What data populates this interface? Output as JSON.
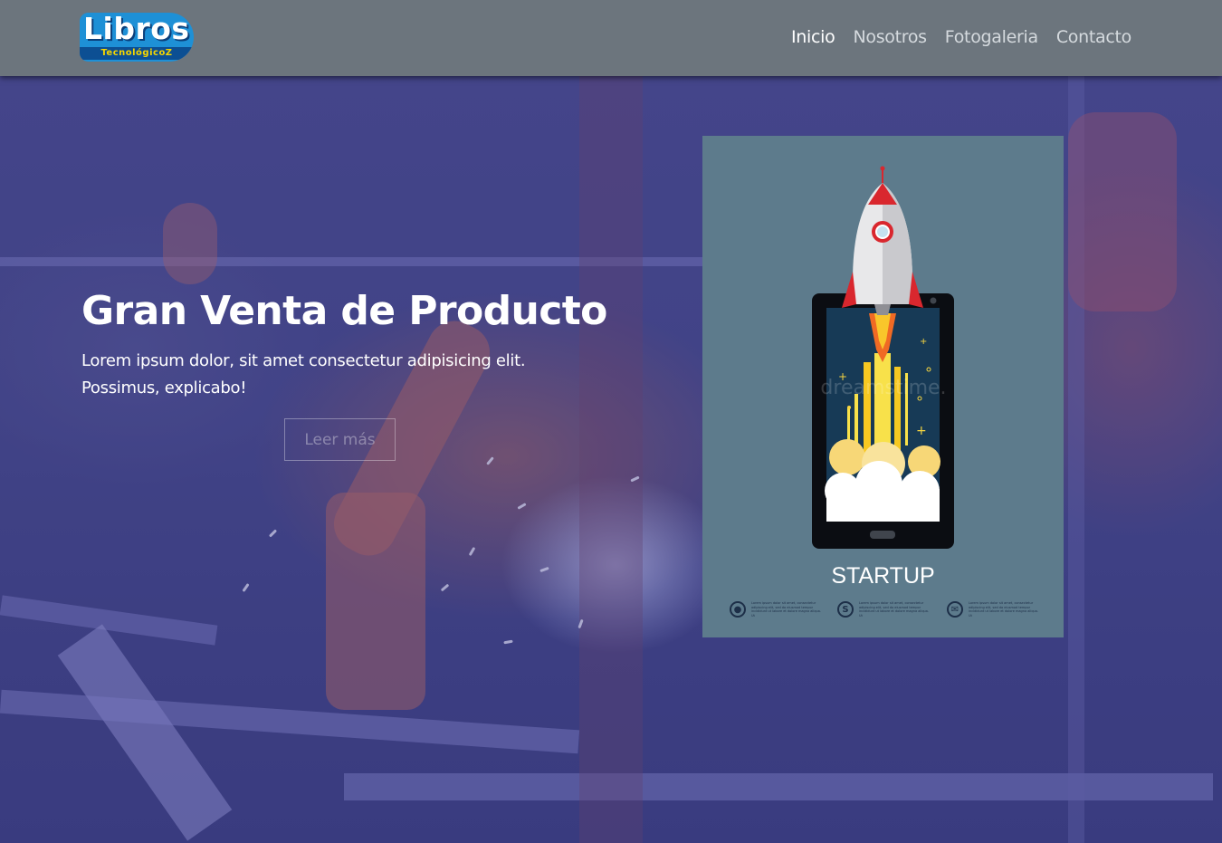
{
  "header": {
    "logo_main": "Libros",
    "logo_sub": "TecnológicoZ",
    "nav": [
      {
        "label": "Inicio",
        "active": true
      },
      {
        "label": "Nosotros",
        "active": false
      },
      {
        "label": "Fotogaleria",
        "active": false
      },
      {
        "label": "Contacto",
        "active": false
      }
    ]
  },
  "hero": {
    "title": "Gran Venta de Producto",
    "text": "Lorem ipsum dolor, sit amet consectetur adipisicing elit. Possimus, explicabo!",
    "button_label": "Leer más"
  },
  "product_card": {
    "title": "STARTUP",
    "watermark": "dreamstime.",
    "features": [
      {
        "icon": "users-icon",
        "symbol": "●",
        "text": "Lorem ipsum dolor sit amet, consectetur adipiscing elit, sed do eiusmod tempor incididunt ut labore et dolore magna aliqua. Ut"
      },
      {
        "icon": "dollar-icon",
        "symbol": "S",
        "text": "Lorem ipsum dolor sit amet, consectetur adipiscing elit, sed do eiusmod tempor incididunt ut labore et dolore magna aliqua. Ut"
      },
      {
        "icon": "mail-icon",
        "symbol": "✉",
        "text": "Lorem ipsum dolor sit amet, consectetur adipiscing elit, sed do eiusmod tempor incididunt ut labore et dolore magna aliqua. Ut"
      }
    ]
  },
  "colors": {
    "header_bg": "#6c757d",
    "card_bg": "#5d7b8c",
    "logo_blue": "#1e90d6",
    "logo_yellow": "#f6d600"
  }
}
